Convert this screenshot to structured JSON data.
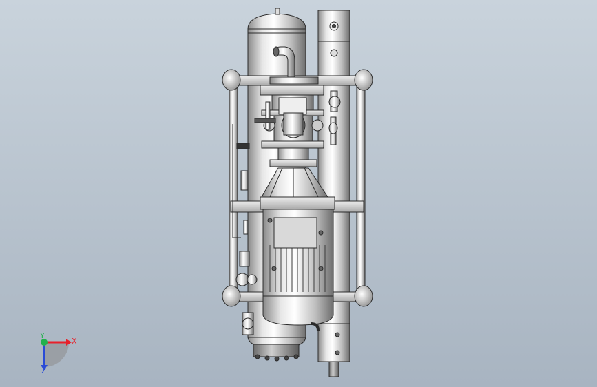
{
  "viewport": {
    "background_top": "#c9d3dc",
    "background_bottom": "#a8b4c1"
  },
  "model": {
    "metal_light": "#f4f4f4",
    "metal_mid": "#c9c9c9",
    "metal_dark": "#7a7a7a",
    "edge_color": "#2b2b2b"
  },
  "triad": {
    "x_label": "X",
    "y_label": "Y",
    "z_label": "Z",
    "x_color": "#e8202a",
    "y_color": "#22b14c",
    "z_color": "#2a4bd7"
  }
}
